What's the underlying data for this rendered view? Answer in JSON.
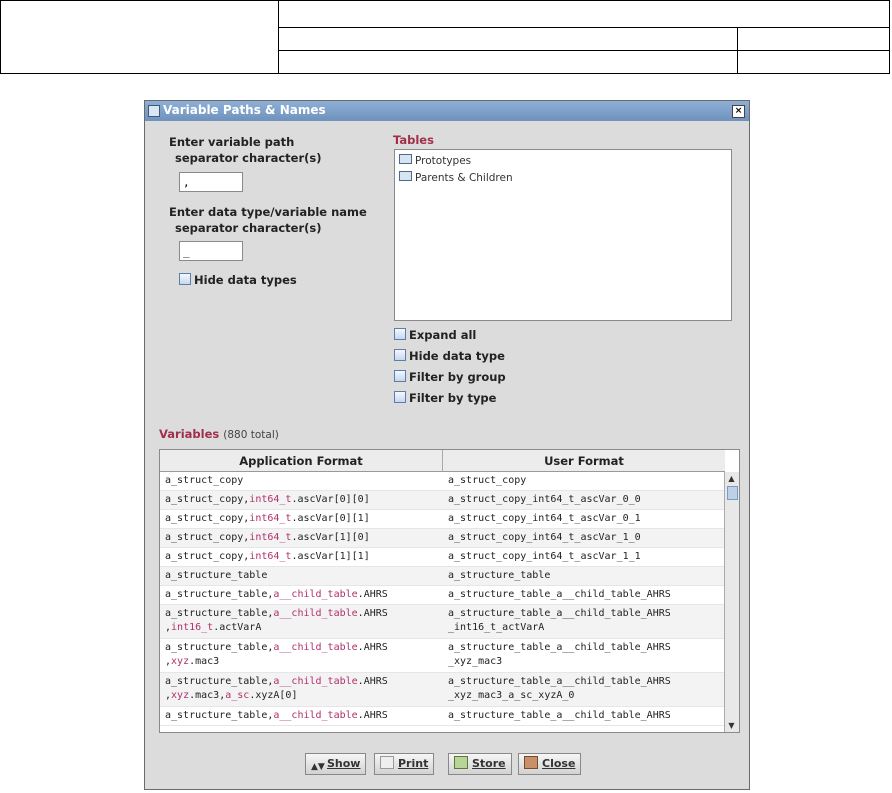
{
  "dialog": {
    "title": "Variable Paths & Names",
    "close_glyph": "×"
  },
  "left": {
    "path_sep_label_1": "Enter variable path",
    "path_sep_label_2": "separator character(s)",
    "path_sep_value": ",",
    "type_sep_label_1": "Enter data type/variable name",
    "type_sep_label_2": "separator character(s)",
    "type_sep_value": "_",
    "hide_types_label": "Hide data types"
  },
  "tables": {
    "label": "Tables",
    "items": [
      "Prototypes",
      "Parents & Children"
    ]
  },
  "options": {
    "expand_all": "Expand all",
    "hide_data_type": "Hide data type",
    "filter_by_group": "Filter by group",
    "filter_by_type": "Filter by type"
  },
  "variables": {
    "label": "Variables",
    "count": "(880 total)",
    "col_app": "Application Format",
    "col_user": "User Format",
    "rows": [
      {
        "app": [
          [
            "a_struct_copy",
            ""
          ]
        ],
        "user": "a_struct_copy",
        "h": 1
      },
      {
        "app": [
          [
            "a_struct_copy,",
            ""
          ],
          [
            "int64_t",
            "hl"
          ],
          [
            ".ascVar[0][0]",
            ""
          ]
        ],
        "user": "a_struct_copy_int64_t_ascVar_0_0",
        "h": 1
      },
      {
        "app": [
          [
            "a_struct_copy,",
            ""
          ],
          [
            "int64_t",
            "hl"
          ],
          [
            ".ascVar[0][1]",
            ""
          ]
        ],
        "user": "a_struct_copy_int64_t_ascVar_0_1",
        "h": 1
      },
      {
        "app": [
          [
            "a_struct_copy,",
            ""
          ],
          [
            "int64_t",
            "hl"
          ],
          [
            ".ascVar[1][0]",
            ""
          ]
        ],
        "user": "a_struct_copy_int64_t_ascVar_1_0",
        "h": 1
      },
      {
        "app": [
          [
            "a_struct_copy,",
            ""
          ],
          [
            "int64_t",
            "hl"
          ],
          [
            ".ascVar[1][1]",
            ""
          ]
        ],
        "user": "a_struct_copy_int64_t_ascVar_1_1",
        "h": 1
      },
      {
        "app": [
          [
            "a_structure_table",
            ""
          ]
        ],
        "user": "a_structure_table",
        "h": 1
      },
      {
        "app": [
          [
            "a_structure_table,",
            ""
          ],
          [
            "a__child_table",
            "hl"
          ],
          [
            ".AHRS",
            ""
          ]
        ],
        "user": "a_structure_table_a__child_table_AHRS",
        "h": 1
      },
      {
        "app": [
          [
            "a_structure_table,",
            ""
          ],
          [
            "a__child_table",
            "hl"
          ],
          [
            ".AHRS\n,",
            ""
          ],
          [
            "int16_t",
            "hl"
          ],
          [
            ".actVarA",
            ""
          ]
        ],
        "user": "a_structure_table_a__child_table_AHRS\n_int16_t_actVarA",
        "h": 2
      },
      {
        "app": [
          [
            "a_structure_table,",
            ""
          ],
          [
            "a__child_table",
            "hl"
          ],
          [
            ".AHRS\n,",
            ""
          ],
          [
            "xyz",
            "hl"
          ],
          [
            ".mac3",
            ""
          ]
        ],
        "user": "a_structure_table_a__child_table_AHRS\n_xyz_mac3",
        "h": 2
      },
      {
        "app": [
          [
            "a_structure_table,",
            ""
          ],
          [
            "a__child_table",
            "hl"
          ],
          [
            ".AHRS\n,",
            ""
          ],
          [
            "xyz",
            "hl"
          ],
          [
            ".mac3,",
            ""
          ],
          [
            "a_sc",
            "hl"
          ],
          [
            ".xyzA[0]",
            ""
          ]
        ],
        "user": "a_structure_table_a__child_table_AHRS\n_xyz_mac3_a_sc_xyzA_0",
        "h": 2
      },
      {
        "app": [
          [
            "a_structure_table,",
            ""
          ],
          [
            "a__child_table",
            "hl"
          ],
          [
            ".AHRS",
            ""
          ]
        ],
        "user": "a_structure_table_a__child_table_AHRS",
        "h": 1
      }
    ]
  },
  "buttons": {
    "show": "Show",
    "print": "Print",
    "store": "Store",
    "close": "Close"
  }
}
